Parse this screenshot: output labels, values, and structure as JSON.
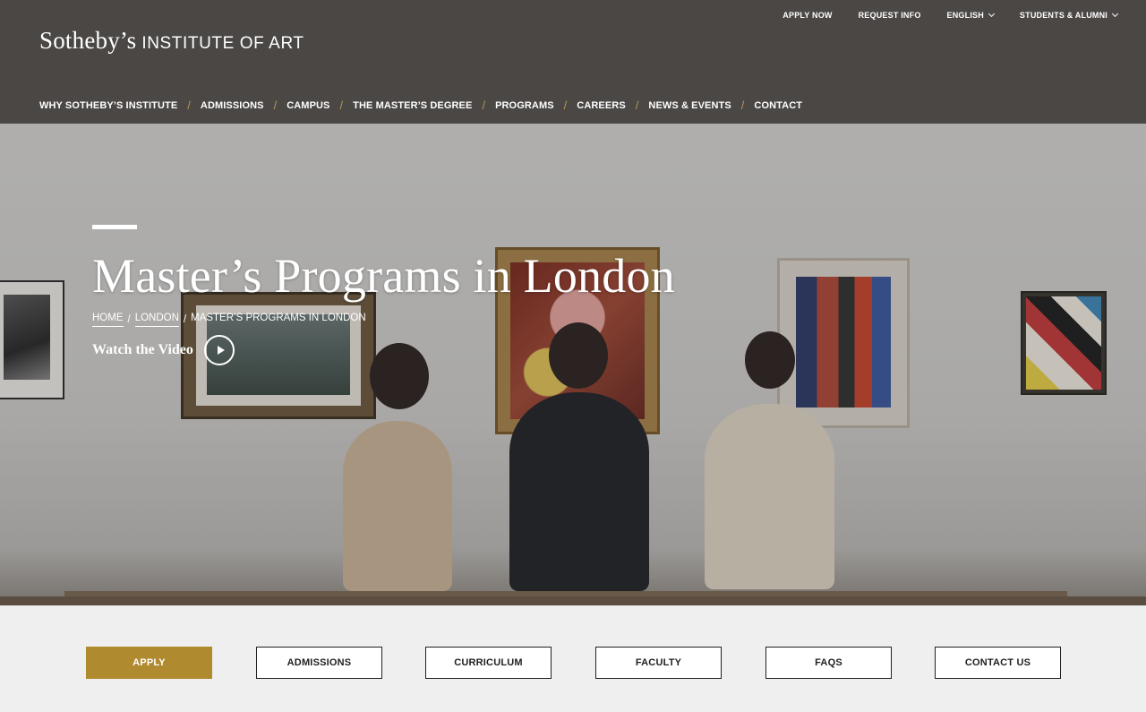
{
  "header": {
    "brand": "Sotheby’s",
    "brand_sub": "INSTITUTE OF ART",
    "utility": {
      "apply_now": "APPLY NOW",
      "request_info": "REQUEST INFO",
      "language": "ENGLISH",
      "students_alumni": "STUDENTS & ALUMNI"
    },
    "nav": [
      "WHY SOTHEBY’S INSTITUTE",
      "ADMISSIONS",
      "CAMPUS",
      "THE MASTER’S DEGREE",
      "PROGRAMS",
      "CAREERS",
      "NEWS & EVENTS",
      "CONTACT"
    ],
    "nav_separator": "/"
  },
  "hero": {
    "title": "Master’s Programs in London",
    "breadcrumb": {
      "home": "HOME",
      "london": "LONDON",
      "current": "MASTER’S PROGRAMS IN LONDON",
      "separator": "/"
    },
    "watch_video": "Watch the Video"
  },
  "actions": {
    "apply": "APPLY",
    "admissions": "ADMISSIONS",
    "curriculum": "CURRICULUM",
    "faculty": "FACULTY",
    "faqs": "FAQS",
    "contact_us": "CONTACT US"
  },
  "colors": {
    "header_bg": "#4a4745",
    "accent_gold": "#b08a2f",
    "nav_separator": "#b7965a",
    "actions_bg": "#efefef"
  }
}
